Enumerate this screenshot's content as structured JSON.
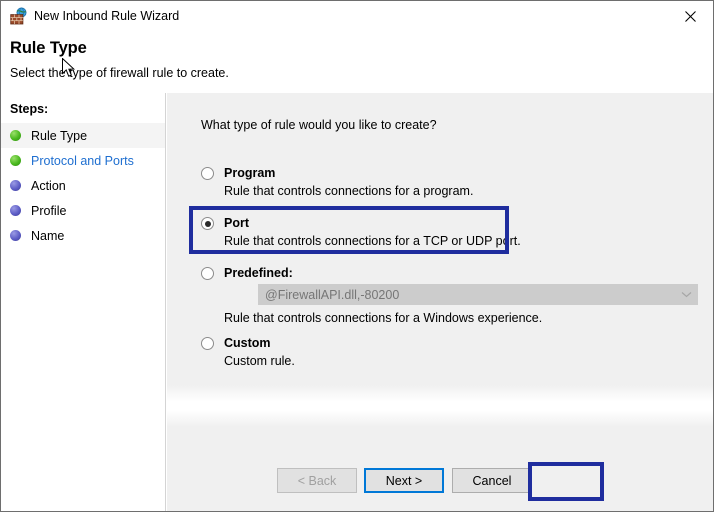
{
  "window": {
    "title": "New Inbound Rule Wizard",
    "icon": "firewall-icon",
    "close_label": "✕"
  },
  "header": {
    "title": "Rule Type",
    "subtitle": "Select the type of firewall rule to create."
  },
  "sidebar": {
    "heading": "Steps:",
    "items": [
      {
        "label": "Rule Type",
        "state": "done",
        "selected": true,
        "link": false
      },
      {
        "label": "Protocol and Ports",
        "state": "done",
        "selected": false,
        "link": true
      },
      {
        "label": "Action",
        "state": "pending",
        "selected": false,
        "link": false
      },
      {
        "label": "Profile",
        "state": "pending",
        "selected": false,
        "link": false
      },
      {
        "label": "Name",
        "state": "pending",
        "selected": false,
        "link": false
      }
    ]
  },
  "main": {
    "question": "What type of rule would you like to create?",
    "options": [
      {
        "id": "program",
        "title": "Program",
        "description": "Rule that controls connections for a program.",
        "checked": false
      },
      {
        "id": "port",
        "title": "Port",
        "description": "Rule that controls connections for a TCP or UDP port.",
        "checked": true
      },
      {
        "id": "predefined",
        "title": "Predefined:",
        "description": "Rule that controls connections for a Windows experience.",
        "checked": false,
        "combo_value": "@FirewallAPI.dll,-80200",
        "combo_disabled": true
      },
      {
        "id": "custom",
        "title": "Custom",
        "description": "Custom rule.",
        "checked": false
      }
    ]
  },
  "footer": {
    "back_label": "< Back",
    "next_label": "Next >",
    "cancel_label": "Cancel",
    "back_disabled": true,
    "next_focused": true
  },
  "annotations": {
    "highlight_color": "#1f2d9e",
    "focus_color": "#0078d7",
    "link_color": "#1f6fd0",
    "targets": [
      "port-option",
      "next-button"
    ]
  }
}
